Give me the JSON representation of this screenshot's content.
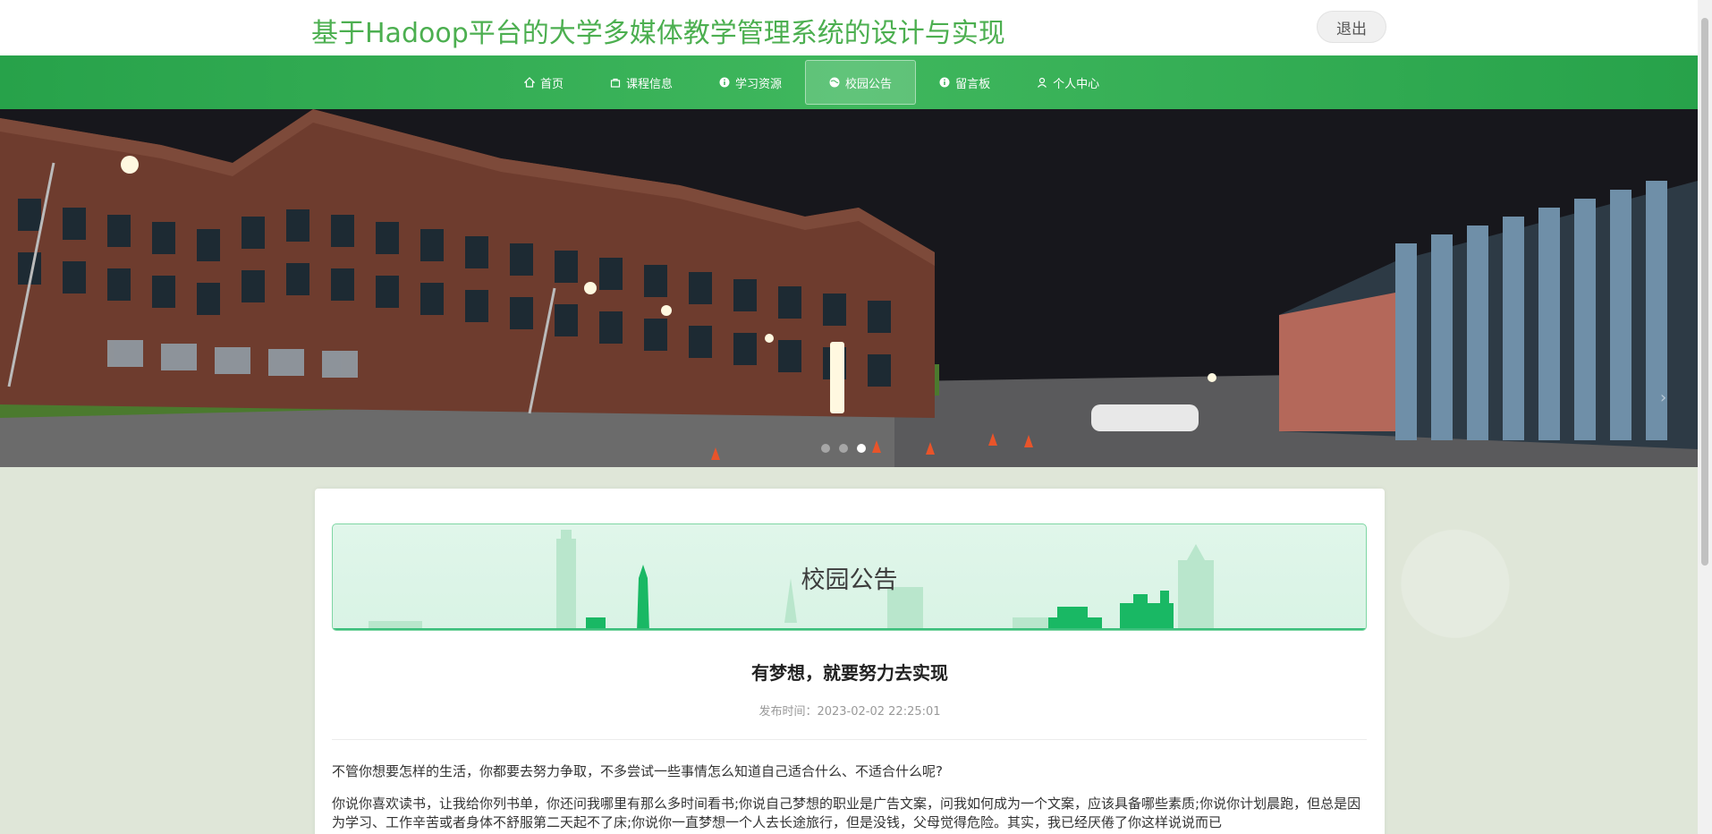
{
  "header": {
    "title": "基于Hadoop平台的大学多媒体教学管理系统的设计与实现",
    "logout_label": "退出"
  },
  "nav": {
    "items": [
      {
        "label": "首页",
        "icon": "home-icon"
      },
      {
        "label": "课程信息",
        "icon": "bag-icon"
      },
      {
        "label": "学习资源",
        "icon": "info-circle-icon"
      },
      {
        "label": "校园公告",
        "icon": "globe-icon"
      },
      {
        "label": "留言板",
        "icon": "info-circle-icon"
      },
      {
        "label": "个人中心",
        "icon": "user-icon"
      }
    ],
    "active_index": 3
  },
  "banner": {
    "slide_count": 3,
    "active_slide": 3
  },
  "notice": {
    "section_title": "校园公告",
    "article_title": "有梦想，就要努力去实现",
    "publish_label": "发布时间：",
    "publish_time": "2023-02-02 22:25:01",
    "paragraph1": "不管你想要怎样的生活，你都要去努力争取，不多尝试一些事情怎么知道自己适合什么、不适合什么呢?",
    "paragraph2": "你说你喜欢读书，让我给你列书单，你还问我哪里有那么多时间看书;你说自己梦想的职业是广告文案，问我如何成为一个文案，应该具备哪些素质;你说你计划晨跑，但总是因为学习、工作辛苦或者身体不舒服第二天起不了床;你说你一直梦想一个人去长途旅行，但是没钱，父母觉得危险。其实，我已经厌倦了你这样说说而已"
  },
  "colors": {
    "brand_green": "#4caf50",
    "nav_green": "#27a24a",
    "accent_mint": "#7fd6a4"
  }
}
